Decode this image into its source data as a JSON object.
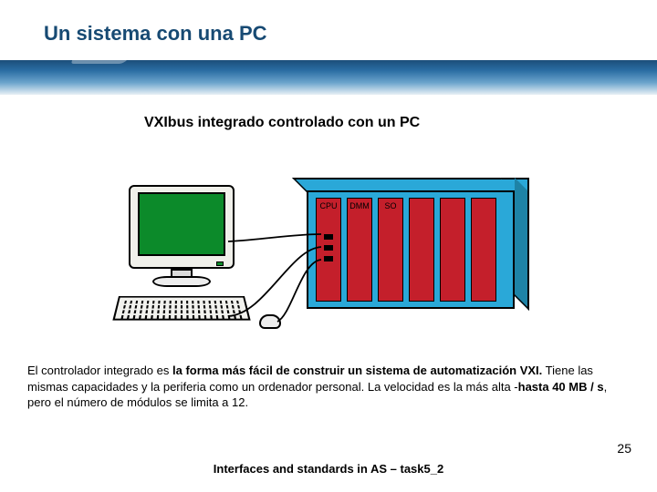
{
  "title": "Un sistema con una PC",
  "subtitle": "VXIbus integrado controlado con un PC",
  "slots": {
    "cpu": "CPU",
    "dmm": "DMM",
    "so": "SO"
  },
  "body": {
    "t1": "El controlador integrado es ",
    "b1": "la forma más fácil de construir un sistema de automatización VXI.",
    "t2": " Tiene ",
    "t2b": "las mismas capacidades y la periferia como un ordenador personal. La velocidad es la más alta -",
    "b2": "hasta 40 MB / s",
    "t3": ", pero el número de módulos se limita a 12."
  },
  "footer": "Interfaces and standards in AS – task5_2",
  "page": "25"
}
